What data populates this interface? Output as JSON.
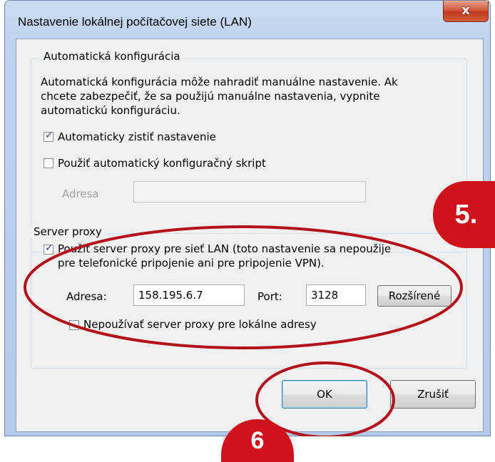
{
  "window": {
    "title": "Nastavenie lokálnej počítačovej siete (LAN)",
    "close_label": "x"
  },
  "auto_config": {
    "group_title": "Automatická konfigurácia",
    "description_lines": [
      "Automatická konfigurácia môže nahradiť manuálne nastavenie. Ak",
      "chcete zabezpečiť, že sa použijú manuálne nastavenia, vypnite",
      "automatickú konfiguráciu."
    ],
    "auto_detect": {
      "label": "Automaticky zistiť nastavenie",
      "checked": true
    },
    "use_script": {
      "label": "Použiť automatický konfiguračný skript",
      "checked": false
    },
    "address_label": "Adresa",
    "address_value": ""
  },
  "proxy": {
    "group_title": "Server proxy",
    "use_proxy": {
      "label_lines": [
        "Použiť server proxy pre sieť LAN (toto nastavenie sa nepoužije",
        "pre telefonické pripojenie ani pre pripojenie VPN)."
      ],
      "checked": true
    },
    "address_label": "Adresa:",
    "address_value": "158.195.6.7",
    "port_label": "Port:",
    "port_value": "3128",
    "advanced_label": "Rozšírené",
    "bypass_local": {
      "label": "Nepoužívať server proxy pre lokálne adresy",
      "checked": false
    }
  },
  "buttons": {
    "ok_label": "OK",
    "cancel_label": "Zrušiť"
  },
  "annotations": {
    "step5": "5.",
    "step6": "6",
    "color": "#d0121b",
    "ellipse_color": "#b3121a"
  }
}
